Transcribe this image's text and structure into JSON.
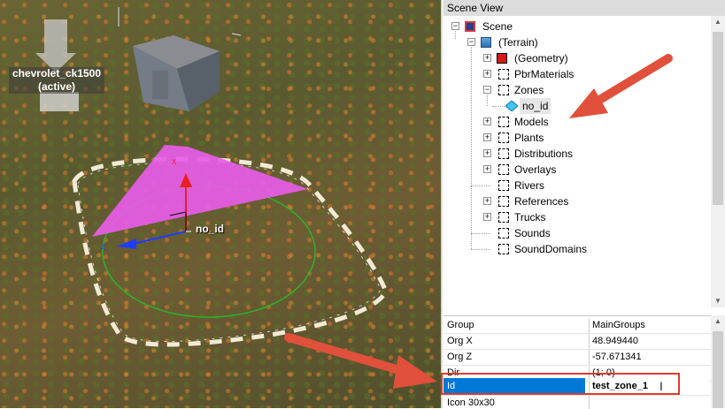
{
  "viewport": {
    "vehicle_label_line1": "chevrolet_ck1500",
    "vehicle_label_line2": "(active)",
    "zone_label": "no_id",
    "gizmo_axis_x": "X",
    "gizmo_axis_z": "Z",
    "colors": {
      "zone": "#e85ce8",
      "accent_arrow": "#e0503a"
    }
  },
  "scene_view": {
    "title": "Scene View",
    "tree": [
      {
        "label": "Scene",
        "icon": "scene-icon",
        "expander": "−"
      },
      {
        "label": "(Terrain)",
        "icon": "terrain-icon",
        "expander": "−"
      },
      {
        "label": "(Geometry)",
        "icon": "geometry-cube-icon",
        "expander": "+"
      },
      {
        "label": "PbrMaterials",
        "icon": "dashed-node-icon",
        "expander": "+"
      },
      {
        "label": "Zones",
        "icon": "dashed-node-icon",
        "expander": "−"
      },
      {
        "label": "no_id",
        "icon": "zone-diamond-icon",
        "expander": ""
      },
      {
        "label": "Models",
        "icon": "dashed-node-icon",
        "expander": "+"
      },
      {
        "label": "Plants",
        "icon": "dashed-node-icon",
        "expander": "+"
      },
      {
        "label": "Distributions",
        "icon": "dashed-node-icon",
        "expander": "+"
      },
      {
        "label": "Overlays",
        "icon": "dashed-node-icon",
        "expander": "+"
      },
      {
        "label": "Rivers",
        "icon": "dashed-node-icon",
        "expander": ""
      },
      {
        "label": "References",
        "icon": "dashed-node-icon",
        "expander": "+"
      },
      {
        "label": "Trucks",
        "icon": "dashed-node-icon",
        "expander": "+"
      },
      {
        "label": "Sounds",
        "icon": "dashed-node-icon",
        "expander": ""
      },
      {
        "label": "SoundDomains",
        "icon": "dashed-node-icon",
        "expander": ""
      }
    ]
  },
  "properties": [
    {
      "name": "Group",
      "value": "MainGroups"
    },
    {
      "name": "Org X",
      "value": "48.949440"
    },
    {
      "name": "Org Z",
      "value": "-57.671341"
    },
    {
      "name": "Dir",
      "value": "(1; 0)"
    },
    {
      "name": "Id",
      "value": "test_zone_1"
    },
    {
      "name": "Icon 30x30",
      "value": ""
    }
  ]
}
